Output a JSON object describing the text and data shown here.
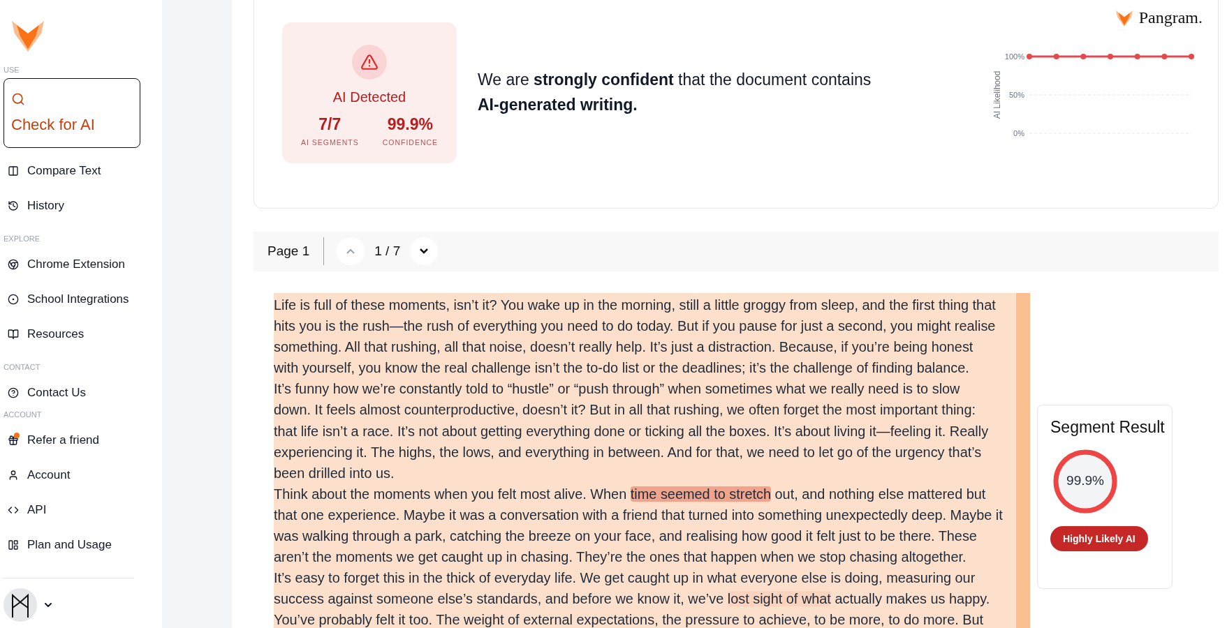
{
  "sidebar": {
    "sections": [
      {
        "label": "USE",
        "items": [
          {
            "label": "Check for AI",
            "selected": true
          },
          {
            "label": "Compare Text",
            "selected": false
          },
          {
            "label": "History",
            "selected": false
          }
        ]
      },
      {
        "label": "EXPLORE",
        "items": [
          {
            "label": "Chrome Extension",
            "selected": false
          },
          {
            "label": "School Integrations",
            "selected": false
          },
          {
            "label": "Resources",
            "selected": false
          }
        ]
      },
      {
        "label": "CONTACT",
        "items": [
          {
            "label": "Contact Us",
            "selected": false
          }
        ]
      },
      {
        "label": "ACCOUNT",
        "items": [
          {
            "label": "Refer a friend",
            "selected": false,
            "notification": true
          },
          {
            "label": "Account",
            "selected": false
          },
          {
            "label": "API",
            "selected": false
          },
          {
            "label": "Plan and Usage",
            "selected": false
          }
        ]
      }
    ]
  },
  "summary": {
    "status": "AI Detected",
    "stats": [
      {
        "value": "7/7",
        "label": "AI SEGMENTS"
      },
      {
        "value": "99.9%",
        "label": "CONFIDENCE"
      }
    ],
    "verdict": "We are **strongly confident** that the document contains **AI-generated writing.**",
    "brand": "Pangram.",
    "chart_data": {
      "type": "line",
      "ylabel": "AI Likelihood",
      "series": [
        {
          "color": "#e5484d",
          "marker": "circle",
          "values": [
            100,
            100,
            100,
            100,
            100,
            100,
            100
          ]
        }
      ],
      "ylim": [
        0,
        100
      ],
      "yticks": [
        {
          "value": 0,
          "label": "0%"
        },
        {
          "value": 50,
          "label": "50%"
        },
        {
          "value": 100,
          "label": "100%"
        }
      ]
    }
  },
  "pager": {
    "label": "Page 1",
    "counter": "1 / 7",
    "prev_disabled": true,
    "next_disabled": false
  },
  "document": {
    "lines": [
      [
        {
          "text": "Life is full of these moments, isn’t it? You wake up in the morning, still a little groggy from sleep, and the first thing that"
        }
      ],
      [
        {
          "text": "hits you is the rush—the rush of everything you need to do today. But if you pause for just a second, you might realise"
        }
      ],
      [
        {
          "text": "something. All that rushing, all that noise, doesn’t really help. It’s just a distraction. Because, if you’re being honest"
        }
      ],
      [
        {
          "text": "with yourself, you know the real challenge isn’t the to-do list or the deadlines; it’s the challenge of finding balance."
        }
      ],
      [
        {
          "text": "It’s funny how we’re constantly told to “hustle” or “push through” when sometimes what we really need is to slow"
        }
      ],
      [
        {
          "text": "down. It feels almost counterproductive, doesn’t it? But in all that rushing, we often forget the most important thing:"
        }
      ],
      [
        {
          "text": "that life isn’t a race. It’s not about getting everything done or ticking all the boxes. It’s about living it—feeling it. Really"
        }
      ],
      [
        {
          "text": "experiencing it. The highs, the lows, and everything in between. And for that, we need to let go of the urgency that’s"
        }
      ],
      [
        {
          "text": "been drilled into us."
        }
      ],
      [
        {
          "text": "Think about the moments when you felt most alive. When "
        },
        {
          "text": "time seemed to stretch",
          "color": "#f0a48c"
        },
        {
          "text": " out, and nothing else mattered but"
        }
      ],
      [
        {
          "text": "that one experience. Maybe it was a conversation with a friend that turned into something unexpectedly deep. Maybe it"
        }
      ],
      [
        {
          "text": "was walking through a park, catching the breeze on your face, and realising how good it felt just to be there. These"
        }
      ],
      [
        {
          "text": "aren’t the moments we get caught up in chasing. They’re the ones that happen when we stop chasing altogether."
        }
      ],
      [
        {
          "text": "It’s easy to forget this in the thick of everyday life. We get caught up in what everyone else is doing, measuring our"
        }
      ],
      [
        {
          "text": "success against someone else’s standards, and before we know it, we’ve "
        },
        {
          "text": "lost sight of what",
          "color": "#fcd4bd"
        },
        {
          "text": " actually makes us happy."
        }
      ],
      [
        {
          "text": "You’ve probably felt it too. The weight of external expectations, the pressure to achieve, to be more, to do more. But"
        }
      ]
    ]
  },
  "segment": {
    "title": "Segment Result",
    "score": "99.9%",
    "level": 0.999,
    "verdict": "Highly Likely AI"
  }
}
